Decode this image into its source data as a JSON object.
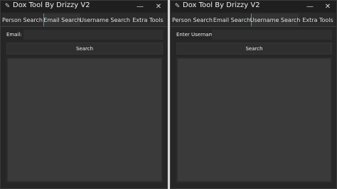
{
  "windows": [
    {
      "title": "Dox Tool By Drizzy V2",
      "app_icon": "feather-icon",
      "controls": {
        "minimize": "—",
        "close": "✕"
      },
      "tabs": [
        "Person Search",
        "Email Search",
        "Username Search",
        "Extra Tools"
      ],
      "active_tab": "Email Search",
      "field_label": "Email:",
      "field_value": "",
      "button_label": "Search",
      "results_text": ""
    },
    {
      "title": "Dox Tool By Drizzy V2",
      "app_icon": "feather-icon",
      "controls": {
        "minimize": "—",
        "close": "✕"
      },
      "tabs": [
        "Person Search",
        "Email Search",
        "Username Search",
        "Extra Tools"
      ],
      "active_tab": "Username Search",
      "field_label": "Enter Username:",
      "field_value": "",
      "button_label": "Search",
      "results_text": ""
    }
  ],
  "colors": {
    "window_bg": "#262626",
    "titlebar_bg": "#1f1f1f",
    "accent": "#1aa3c7",
    "output_bg": "#3a3a3a"
  }
}
